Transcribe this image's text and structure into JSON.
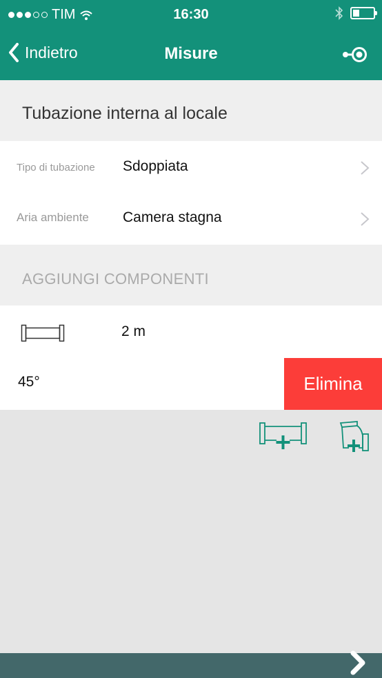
{
  "status_bar": {
    "carrier": "TIM",
    "time": "16:30"
  },
  "nav": {
    "back_label": "Indietro",
    "title": "Misure"
  },
  "section_pipe": {
    "title": "Tubazione interna al locale"
  },
  "rows": [
    {
      "label": "Tipo di tubazione",
      "value": "Sdoppiata"
    },
    {
      "label": "Aria ambiente",
      "value": "Camera stagna"
    }
  ],
  "section_components": {
    "title": "AGGIUNGI COMPONENTI"
  },
  "components": [
    {
      "icon": "straight-pipe-icon",
      "value": "2 m"
    },
    {
      "icon": "",
      "value": "45°"
    }
  ],
  "delete_label": "Elimina",
  "colors": {
    "primary": "#13917a",
    "delete": "#fc3d39",
    "bottom_bar": "#43686a"
  }
}
